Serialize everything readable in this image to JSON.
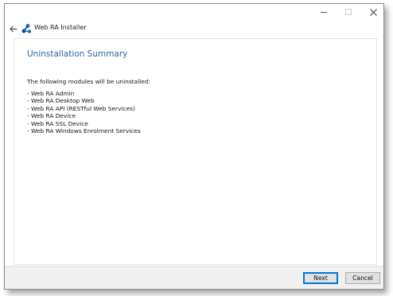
{
  "window": {
    "title": "Web RA Installer"
  },
  "page": {
    "title": "Uninstallation Summary",
    "intro": "The following modules will be uninstalled:",
    "modules": [
      "- Web RA Admin",
      "- Web RA Desktop Web",
      "- Web RA API (RESTful Web Services)",
      "- Web RA Device",
      "- Web RA SSL Device",
      "- Web RA Windows Enrolment Services"
    ]
  },
  "footer": {
    "next_label": "Next",
    "cancel_label": "Cancel"
  },
  "colors": {
    "title_blue": "#2e5fa3",
    "logo_blue": "#1a73b8",
    "logo_dark": "#0b3d6e",
    "focus_blue": "#0078d7"
  },
  "icons": {
    "back": "back-arrow-icon",
    "logo": "app-logo-icon",
    "minimize": "minimize-icon",
    "maximize": "maximize-icon",
    "close": "close-icon"
  }
}
